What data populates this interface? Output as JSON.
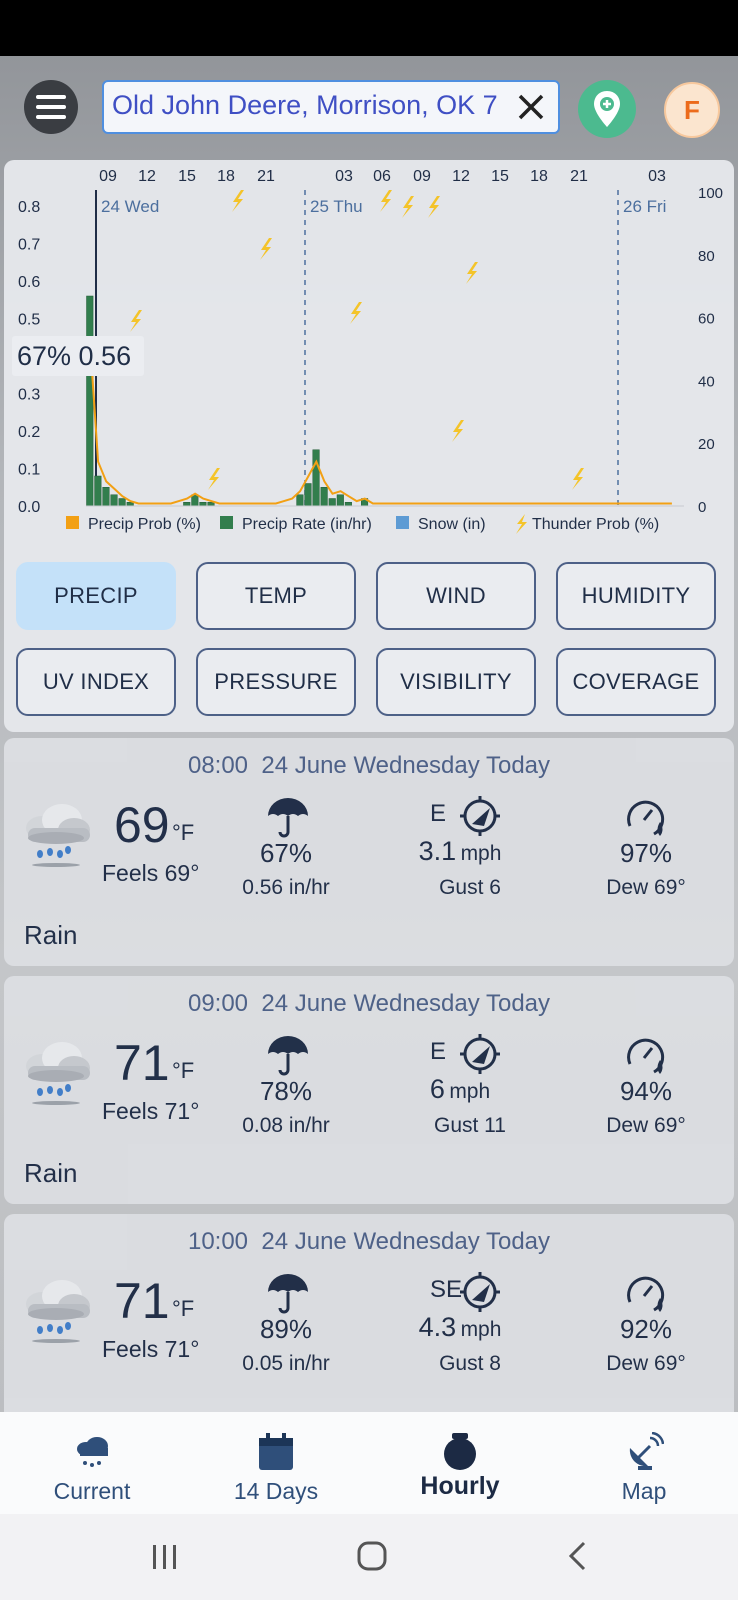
{
  "header": {
    "location_text": "Old John Deere, Morrison, OK 7",
    "unit_button": "F"
  },
  "chart_data": {
    "type": "bar",
    "x_time_labels": [
      "09",
      "12",
      "15",
      "18",
      "21",
      "03",
      "06",
      "09",
      "12",
      "15",
      "18",
      "21",
      "03"
    ],
    "day_labels": [
      "24 Wed",
      "25 Thu",
      "26 Fri"
    ],
    "left_axis_ticks": [
      "0.8",
      "0.7",
      "0.6",
      "0.5",
      "0.4",
      "0.3",
      "0.2",
      "0.1",
      "0.0"
    ],
    "right_axis_ticks": [
      "100",
      "80",
      "60",
      "40",
      "20",
      "0"
    ],
    "ylim_left": [
      0,
      0.8
    ],
    "ylim_right": [
      0,
      100
    ],
    "tooltip": "67% 0.56",
    "series": [
      {
        "name": "Precip Rate (in/hr)",
        "values": [
          0.56,
          0.08,
          0.05,
          0.03,
          0.02,
          0.01,
          0,
          0,
          0,
          0,
          0,
          0,
          0.01,
          0.03,
          0.01,
          0.01,
          0,
          0,
          0,
          0,
          0,
          0,
          0,
          0,
          0,
          0,
          0.03,
          0.06,
          0.15,
          0.05,
          0.02,
          0.03,
          0.01,
          0,
          0.02,
          0,
          0,
          0,
          0,
          0,
          0,
          0,
          0,
          0,
          0,
          0,
          0,
          0,
          0,
          0,
          0,
          0,
          0,
          0,
          0,
          0,
          0,
          0,
          0,
          0,
          0,
          0,
          0,
          0,
          0,
          0,
          0,
          0,
          0,
          0,
          0,
          0,
          0,
          0
        ]
      },
      {
        "name": "Precip Prob (%)",
        "values": [
          67,
          18,
          10,
          7,
          4,
          2,
          1,
          1,
          1,
          1,
          1,
          2,
          3,
          5,
          3,
          2,
          1,
          1,
          1,
          1,
          1,
          1,
          1,
          1,
          2,
          3,
          6,
          12,
          18,
          10,
          5,
          6,
          4,
          2,
          3,
          1,
          1,
          1,
          1,
          1,
          1,
          1,
          1,
          1,
          1,
          1,
          1,
          1,
          1,
          1,
          1,
          1,
          1,
          1,
          1,
          1,
          1,
          1,
          1,
          1,
          1,
          1,
          1,
          1,
          1,
          1,
          1,
          1,
          1,
          1,
          1,
          1,
          1
        ]
      },
      {
        "name": "Snow (in)",
        "values": []
      },
      {
        "name": "Thunder Prob (%)",
        "values": []
      }
    ],
    "colors": {
      "precip_rate": "#2e7d4a",
      "precip_prob": "#f5a00f",
      "snow": "#5b9bd5",
      "thunder": "#f7c525"
    }
  },
  "tabs": [
    "PRECIP",
    "TEMP",
    "WIND",
    "HUMIDITY",
    "UV INDEX",
    "PRESSURE",
    "VISIBILITY",
    "COVERAGE"
  ],
  "hours": [
    {
      "time": "08:00",
      "date": "24 June Wednesday Today",
      "temp": "69",
      "unit": "°F",
      "feels": "Feels 69°",
      "condition": "Rain",
      "prob": "67%",
      "rate": "0.56 in/hr",
      "wind_dir": "E",
      "wind_speed": "3.1",
      "wind_unit": "mph",
      "gust": "Gust 6",
      "humidity": "97%",
      "dew": "Dew 69°"
    },
    {
      "time": "09:00",
      "date": "24 June Wednesday Today",
      "temp": "71",
      "unit": "°F",
      "feels": "Feels 71°",
      "condition": "Rain",
      "prob": "78%",
      "rate": "0.08 in/hr",
      "wind_dir": "E",
      "wind_speed": "6",
      "wind_unit": "mph",
      "gust": "Gust 11",
      "humidity": "94%",
      "dew": "Dew 69°"
    },
    {
      "time": "10:00",
      "date": "24 June Wednesday Today",
      "temp": "71",
      "unit": "°F",
      "feels": "Feels 71°",
      "condition": "",
      "prob": "89%",
      "rate": "0.05 in/hr",
      "wind_dir": "SE",
      "wind_speed": "4.3",
      "wind_unit": "mph",
      "gust": "Gust 8",
      "humidity": "92%",
      "dew": "Dew 69°"
    }
  ],
  "nav": [
    {
      "label": "Current",
      "icon": "rain-cloud-icon"
    },
    {
      "label": "14 Days",
      "icon": "calendar-icon"
    },
    {
      "label": "Hourly",
      "icon": "clock-icon"
    },
    {
      "label": "Map",
      "icon": "satellite-dish-icon"
    }
  ]
}
